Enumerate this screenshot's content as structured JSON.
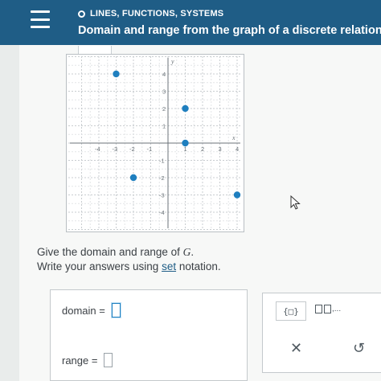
{
  "header": {
    "topic": "LINES, FUNCTIONS, SYSTEMS",
    "title": "Domain and range from the graph of a discrete relation"
  },
  "graph": {
    "x_label": "x",
    "y_label": "y",
    "x_ticks": [
      -4,
      -3,
      -2,
      -1,
      1,
      2,
      3,
      4
    ],
    "y_ticks": [
      4,
      3,
      2,
      1,
      -1,
      -2,
      -3,
      -4
    ],
    "points": [
      {
        "x": -3,
        "y": 4
      },
      {
        "x": 1,
        "y": 2
      },
      {
        "x": 1,
        "y": 0
      },
      {
        "x": -2,
        "y": -2
      },
      {
        "x": 4,
        "y": -3
      }
    ],
    "point_color": "#1f7fbf"
  },
  "prompt": {
    "line1_prefix": "Give the domain and range of ",
    "line1_var": "G",
    "line1_suffix": ".",
    "line2_prefix": "Write your answers using ",
    "line2_link": "set",
    "line2_suffix": " notation."
  },
  "answers": {
    "domain_label": "domain  =",
    "range_label": "range  ="
  },
  "tools": {
    "set_icon": "{□}",
    "list_suffix": ",...",
    "clear_icon": "✕",
    "undo_icon": "↺"
  },
  "colors": {
    "header_bg": "#1f5d86",
    "accent": "#1f7fbf"
  }
}
